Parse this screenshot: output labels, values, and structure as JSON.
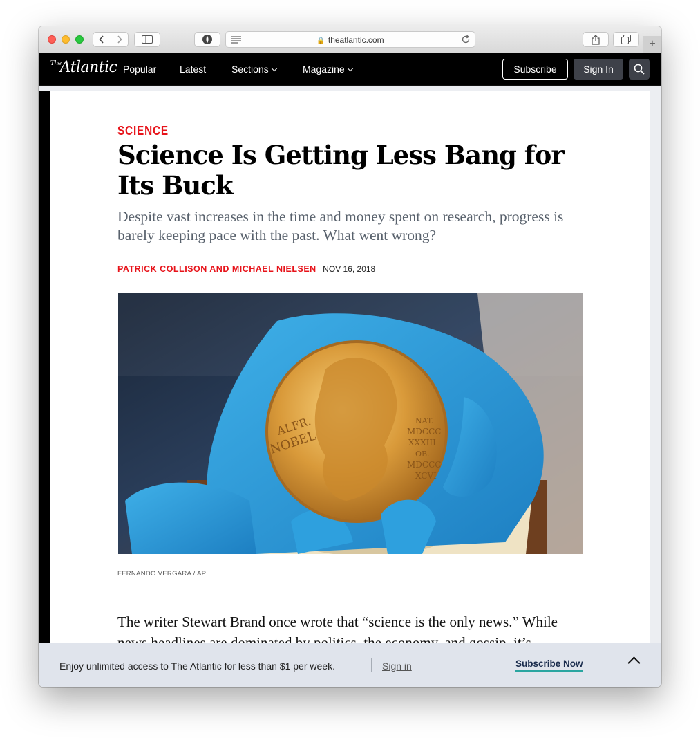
{
  "browser": {
    "url": "theatlantic.com"
  },
  "nav": {
    "logo_small": "The",
    "logo_main": "Atlantic",
    "links": [
      "Popular",
      "Latest",
      "Sections",
      "Magazine"
    ],
    "subscribe": "Subscribe",
    "sign_in": "Sign In"
  },
  "article": {
    "kicker": "SCIENCE",
    "headline": "Science Is Getting Less Bang for Its Buck",
    "dek": "Despite vast increases in the time and money spent on research, progress is barely keeping pace with the past. What went wrong?",
    "authors": "PATRICK COLLISON AND MICHAEL NIELSEN",
    "date": "NOV 16, 2018",
    "medal_text_left": "ALFR. NOBEL",
    "medal_text_right": "NAT. MDCCC XXXIII OB. MDCCC XCVI",
    "caption": "FERNANDO VERGARA / AP",
    "body": "The writer Stewart Brand once wrote that “science is the only news.” While news headlines are dominated by politics, the economy, and gossip, it’s"
  },
  "banner": {
    "text": "Enjoy unlimited access to The Atlantic for less than $1 per week.",
    "sign_in": "Sign in",
    "cta": "Subscribe Now"
  },
  "colors": {
    "accent_red": "#e7131a",
    "nav_bg": "#000000",
    "banner_bg": "#e0e4ec",
    "cta_underline": "#2aa5a0"
  }
}
